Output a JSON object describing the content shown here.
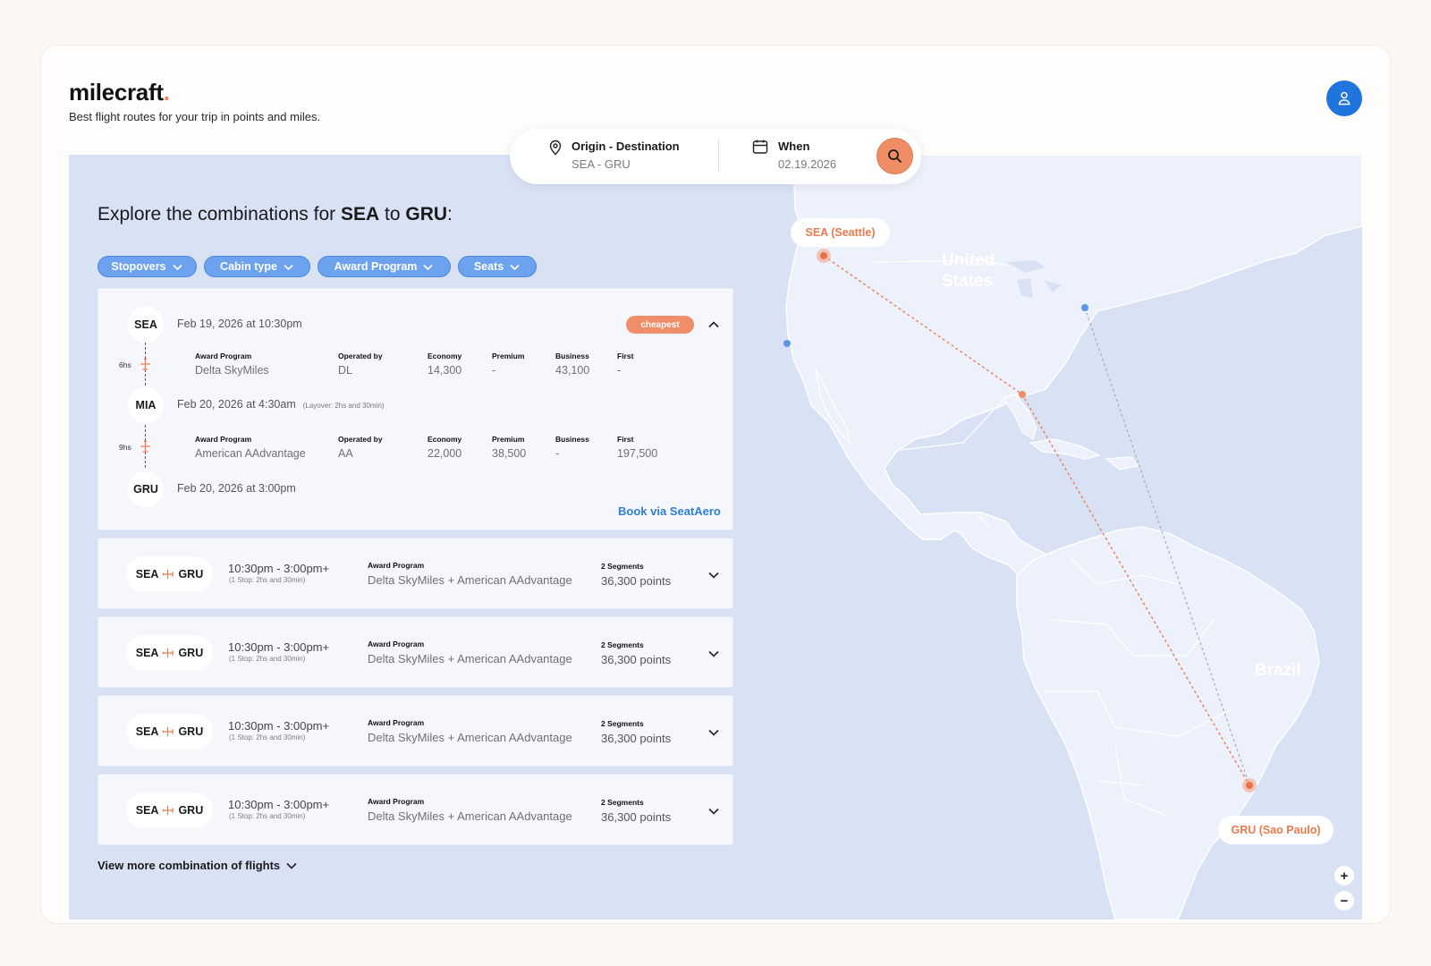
{
  "brand": {
    "name": "milecraft",
    "dot": ".",
    "tagline": "Best flight routes for your trip in points and miles."
  },
  "account": {
    "icon": "user-icon"
  },
  "search": {
    "origin_title": "Origin - Destination",
    "origin_value": "SEA  -  GRU",
    "when_title": "When",
    "when_value": "02.19.2026",
    "button_icon": "search-icon"
  },
  "headline": {
    "prefix": "Explore the combinations for ",
    "from": "SEA",
    "mid": " to ",
    "to": "GRU",
    "suffix": ":"
  },
  "filters": [
    "Stopovers",
    "Cabin type",
    "Award Program",
    "Seats"
  ],
  "expanded": {
    "badge": "cheapest",
    "stops": [
      {
        "code": "SEA",
        "time": "Feb 19, 2026 at 10:30pm",
        "note": ""
      },
      {
        "code": "MIA",
        "time": "Feb 20, 2026 at 4:30am",
        "note": "(Layover: 2hs and 30min)"
      },
      {
        "code": "GRU",
        "time": "Feb 20, 2026 at 3:00pm",
        "note": ""
      }
    ],
    "legs": [
      {
        "duration": "6hs",
        "program": "Delta SkyMiles",
        "operator": "DL",
        "economy": "14,300",
        "premium": "-",
        "business": "43,100",
        "first": "-"
      },
      {
        "duration": "9hs",
        "program": "American AAdvantage",
        "operator": "AA",
        "economy": "22,000",
        "premium": "38,500",
        "business": "-",
        "first": "197,500"
      }
    ],
    "headers": {
      "program": "Award Program",
      "operator": "Operated by",
      "economy": "Economy",
      "premium": "Premium",
      "business": "Business",
      "first": "First"
    },
    "book_link": "Book via SeatAero"
  },
  "results": [
    {
      "from": "SEA",
      "to": "GRU",
      "time": "10:30pm - 3:00pm+",
      "stop": "(1 Stop: 2hs and 30min)",
      "program_label": "Award Program",
      "program": "Delta SkyMiles + American AAdvantage",
      "segments": "2 Segments",
      "points": "36,300 points"
    },
    {
      "from": "SEA",
      "to": "GRU",
      "time": "10:30pm - 3:00pm+",
      "stop": "(1 Stop: 2hs and 30min)",
      "program_label": "Award Program",
      "program": "Delta SkyMiles + American AAdvantage",
      "segments": "2 Segments",
      "points": "36,300 points"
    },
    {
      "from": "SEA",
      "to": "GRU",
      "time": "10:30pm - 3:00pm+",
      "stop": "(1 Stop: 2hs and 30min)",
      "program_label": "Award Program",
      "program": "Delta SkyMiles + American AAdvantage",
      "segments": "2 Segments",
      "points": "36,300 points"
    },
    {
      "from": "SEA",
      "to": "GRU",
      "time": "10:30pm - 3:00pm+",
      "stop": "(1 Stop: 2hs and 30min)",
      "program_label": "Award Program",
      "program": "Delta SkyMiles + American AAdvantage",
      "segments": "2 Segments",
      "points": "36,300 points"
    }
  ],
  "view_more": "View more combination of flights",
  "map": {
    "origin_label": "SEA (Seattle)",
    "destination_label": "GRU (Sao Paulo)",
    "country_us_line1": "United",
    "country_us_line2": "States",
    "country_brazil": "Brazil",
    "zoom_in": "+",
    "zoom_out": "−"
  },
  "colors": {
    "accent": "#ee7e54",
    "primary": "#1f74de",
    "chip": "#6da2ee",
    "map_bg": "#d8e2f4",
    "land": "#edf1fb"
  }
}
